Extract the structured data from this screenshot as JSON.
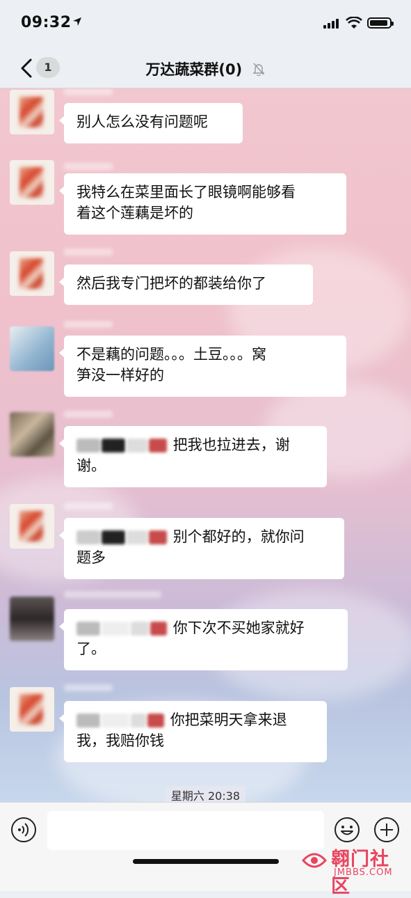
{
  "status": {
    "time": "09:32"
  },
  "nav": {
    "back_badge": "1",
    "title": "万达蔬菜群(0)"
  },
  "messages": [
    {
      "avatar": "avatar-1",
      "text": "别人怎么没有问题呢"
    },
    {
      "avatar": "avatar-1",
      "line1": "我特么在菜里面长了眼镜啊能够看",
      "line2": "着这个莲藕是坏的"
    },
    {
      "avatar": "avatar-1",
      "text": "然后我专门把坏的都装给你了"
    },
    {
      "avatar": "avatar-2",
      "line1": "不是藕的问题。。。土豆。。。窝",
      "line2": "笋没一样好的"
    },
    {
      "avatar": "avatar-3",
      "line1": "把我也拉进去，谢",
      "line2": "谢。"
    },
    {
      "avatar": "avatar-1",
      "line1": "别个都好的，就你问",
      "line2": "题多"
    },
    {
      "avatar": "avatar-4",
      "line1": "你下次不买她家就好",
      "line2": "了。"
    },
    {
      "avatar": "avatar-1",
      "line1": "你把菜明天拿来退",
      "line2": "我，我赔你钱"
    }
  ],
  "timestamp": "星期六 20:38",
  "watermark": {
    "main": "翱门社区",
    "sub": "JMBBS.COM"
  },
  "colors": {
    "accent": "#e8455f",
    "bubble": "#ffffff",
    "chat_bg_top": "#f2c7cf"
  }
}
